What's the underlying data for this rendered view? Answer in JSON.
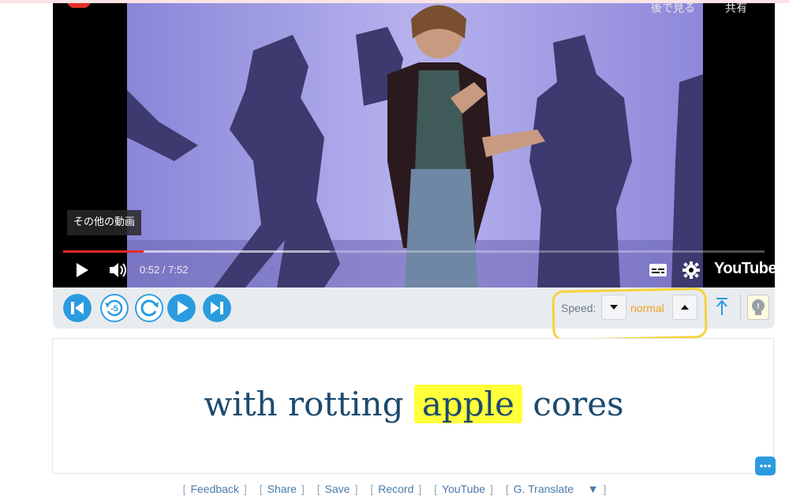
{
  "player": {
    "top_right": [
      "後で見る",
      "共有"
    ],
    "more_videos_label": "その他の動画",
    "time_display": "0:52 / 7:52",
    "progress_fraction": 0.115,
    "buffer_fraction": 0.38,
    "brand": "YouTube",
    "icons": [
      "play-icon",
      "volume-icon",
      "subtitles-icon",
      "settings-icon"
    ]
  },
  "controls": {
    "buttons": [
      "skip-back-icon",
      "replay-5-icon",
      "replay-icon",
      "play-icon",
      "skip-forward-icon"
    ],
    "speed_label": "Speed:",
    "speed_value": "normal",
    "accent_color": "#2b9be0",
    "highlight_color": "#f6d33a"
  },
  "caption": {
    "before": "with rotting ",
    "highlight": "apple",
    "after": " cores"
  },
  "footer": {
    "links": [
      "Feedback",
      "Share",
      "Save",
      "Record",
      "YouTube",
      "G. Translate"
    ],
    "dropdown_glyph": "▼"
  }
}
